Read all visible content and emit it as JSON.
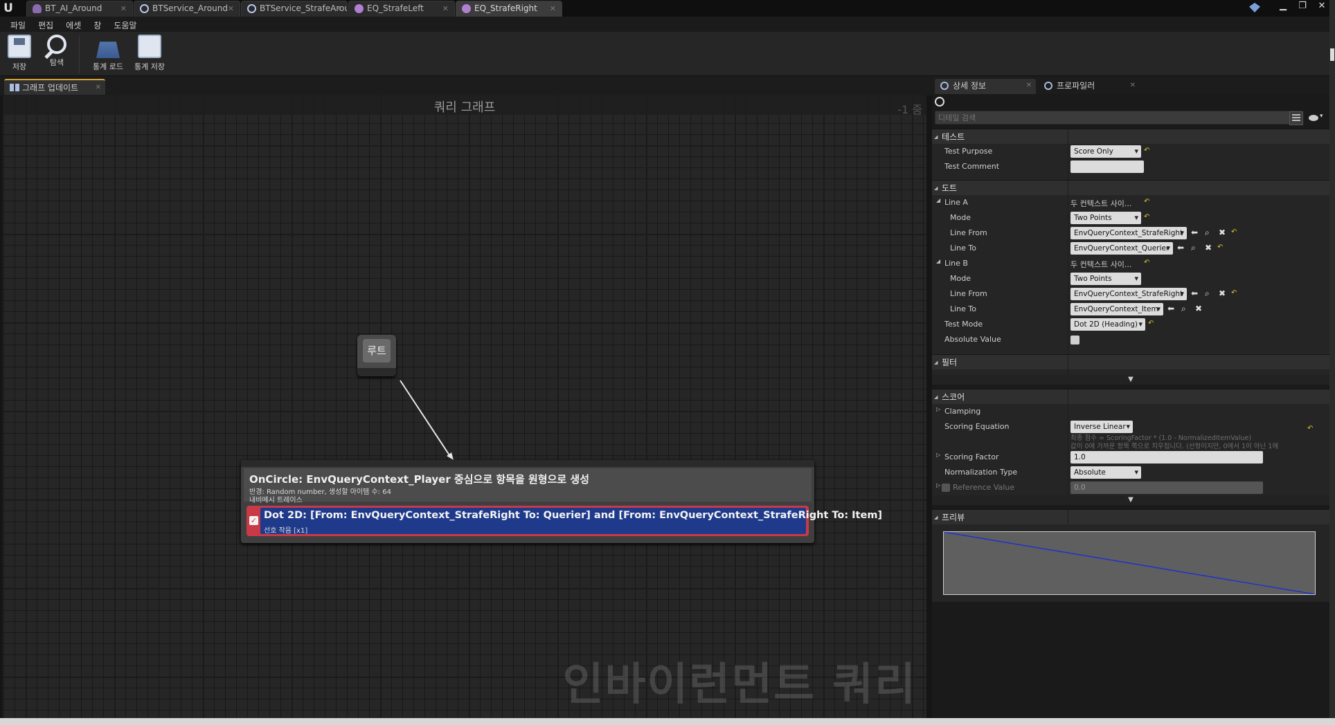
{
  "tabs": [
    {
      "label": "BT_AI_Around",
      "icon": "behavior-tree-icon"
    },
    {
      "label": "BTService_Around",
      "icon": "blueprint-circle-icon"
    },
    {
      "label": "BTService_StrafeAround",
      "icon": "blueprint-circle-icon"
    },
    {
      "label": "EQ_StrafeLeft",
      "icon": "env-query-icon"
    },
    {
      "label": "EQ_StrafeRight",
      "icon": "env-query-icon"
    }
  ],
  "menu": [
    "파일",
    "편집",
    "에셋",
    "창",
    "도움말"
  ],
  "toolbar": {
    "save": "저장",
    "browse": "탐색",
    "load_stats": "통계 로드",
    "save_stats": "통계 저장"
  },
  "graph": {
    "tab_label": "그래프 업데이트",
    "title": "쿼리 그래프",
    "zoom": "-1 줌",
    "watermark": "인바이런먼트 쿼리",
    "root_label": "루트",
    "generator": {
      "title": "OnCircle: EnvQueryContext_Player 중심으로 항목을 원형으로 생성",
      "line1": "반경: Random number, 생성할 아이템 수: 64",
      "line2": "내비메시 트레이스"
    },
    "test": {
      "title": "Dot 2D: [From: EnvQueryContext_StrafeRight To: Querier] and [From: EnvQueryContext_StrafeRight To: Item]",
      "sub": "선호 작음 [x1]"
    }
  },
  "details": {
    "tab_details": "상세 정보",
    "tab_profiler": "프로파일러",
    "search_placeholder": "디테일 검색",
    "cat_test": "테스트",
    "test_purpose_label": "Test Purpose",
    "test_purpose_value": "Score Only",
    "test_comment_label": "Test Comment",
    "test_comment_value": "",
    "cat_dot": "도트",
    "line_a_label": "Line A",
    "line_a_value": "두 컨텍스트 사이...",
    "mode_label": "Mode",
    "mode_value": "Two Points",
    "line_from_label": "Line From",
    "line_from_value": "EnvQueryContext_StrafeRight",
    "line_to_label": "Line To",
    "line_to_a_value": "EnvQueryContext_Querier",
    "line_b_label": "Line B",
    "line_b_value": "두 컨텍스트 사이...",
    "line_to_b_value": "EnvQueryContext_Item",
    "test_mode_label": "Test Mode",
    "test_mode_value": "Dot 2D (Heading)",
    "absolute_value_label": "Absolute Value",
    "cat_filter": "필터",
    "cat_score": "스코어",
    "clamping_label": "Clamping",
    "scoring_equation_label": "Scoring Equation",
    "scoring_equation_value": "Inverse Linear",
    "scoring_desc1": "최종 점수 = ScoringFactor * (1.0 - NormalizedItemValue)",
    "scoring_desc2": "값이 0에 가까운 항목 쪽으로 치우칩니다. (선형이지만, 0에서 1이 아닌 1에",
    "scoring_factor_label": "Scoring Factor",
    "scoring_factor_value": "1.0",
    "normalization_label": "Normalization Type",
    "normalization_value": "Absolute",
    "reference_label": "Reference Value",
    "reference_value": "0.0",
    "cat_preview": "프리뷰"
  },
  "preview_curve": {
    "x": [
      0,
      1
    ],
    "y": [
      1,
      0
    ],
    "line_color": "#1f2fd0"
  },
  "colors": {
    "accent": "#d7a23a",
    "test_node_border": "#c83a48",
    "test_node_fill": "#1f3a8a",
    "reset_arrow": "#d4c330"
  }
}
